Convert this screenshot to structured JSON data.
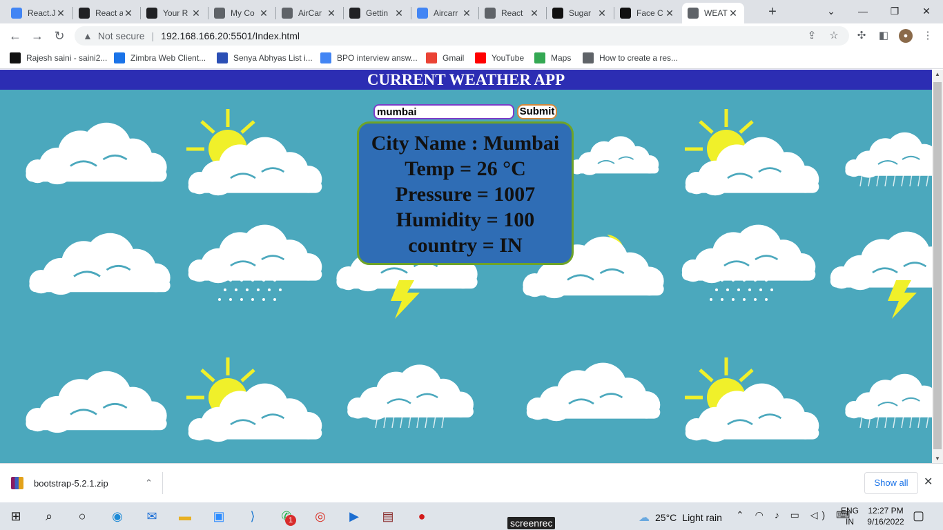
{
  "browser": {
    "tabs": [
      {
        "title": "React.J",
        "icon": "docs-icon",
        "color": "#4285f4"
      },
      {
        "title": "React a",
        "icon": "react-icon",
        "color": "#202124"
      },
      {
        "title": "Your R",
        "icon": "github-icon",
        "color": "#202124"
      },
      {
        "title": "My Co",
        "icon": "globe-icon",
        "color": "#5f6368"
      },
      {
        "title": "AirCar",
        "icon": "globe-icon",
        "color": "#5f6368"
      },
      {
        "title": "Gettin",
        "icon": "react-icon",
        "color": "#202124"
      },
      {
        "title": "Aircarr",
        "icon": "docs-icon",
        "color": "#4285f4"
      },
      {
        "title": "React",
        "icon": "globe-icon",
        "color": "#5f6368"
      },
      {
        "title": "Sugar",
        "icon": "s-icon",
        "color": "#111111"
      },
      {
        "title": "Face C",
        "icon": "s-icon",
        "color": "#111111"
      },
      {
        "title": "WEATH",
        "icon": "globe-icon",
        "color": "#5f6368",
        "active": true
      }
    ],
    "address": {
      "security": "Not secure",
      "url": "192.168.166.20:5501/Index.html"
    },
    "bookmarks": [
      {
        "label": "Rajesh saini - saini2...",
        "icon": "nh-icon",
        "color": "#111111"
      },
      {
        "label": "Zimbra Web Client...",
        "icon": "zimbra-icon",
        "color": "#1a73e8"
      },
      {
        "label": "Senya Abhyas List i...",
        "icon": "gk-icon",
        "color": "#2b4fb5"
      },
      {
        "label": "BPO interview answ...",
        "icon": "docs-icon",
        "color": "#4285f4"
      },
      {
        "label": "Gmail",
        "icon": "gmail-icon",
        "color": "#ea4335"
      },
      {
        "label": "YouTube",
        "icon": "youtube-icon",
        "color": "#ff0000"
      },
      {
        "label": "Maps",
        "icon": "maps-icon",
        "color": "#34a853"
      },
      {
        "label": "How to create a res...",
        "icon": "diamond-icon",
        "color": "#5f6368"
      }
    ]
  },
  "app": {
    "header": "CURRENT WEATHER APP",
    "search": {
      "value": "mumbai"
    },
    "submit_label": "Submit",
    "result": {
      "city": "City Name : Mumbai",
      "temp": "Temp = 26 °C",
      "pressure": "Pressure = 1007",
      "humidity": "Humidity = 100",
      "country": "country = IN"
    },
    "colors": {
      "background": "#4ba8bd",
      "header": "#2c2db3",
      "card": "#2f6db5",
      "card_border": "#6ea328"
    }
  },
  "downloads": {
    "file": "bootstrap-5.2.1.zip",
    "show_all": "Show all"
  },
  "taskbar": {
    "weather_temp": "25°C",
    "weather_text": "Light rain",
    "lang_top": "ENG",
    "lang_bottom": "IN",
    "time": "12:27 PM",
    "date": "9/16/2022",
    "badge": "1",
    "screenrec": "screenrec"
  }
}
